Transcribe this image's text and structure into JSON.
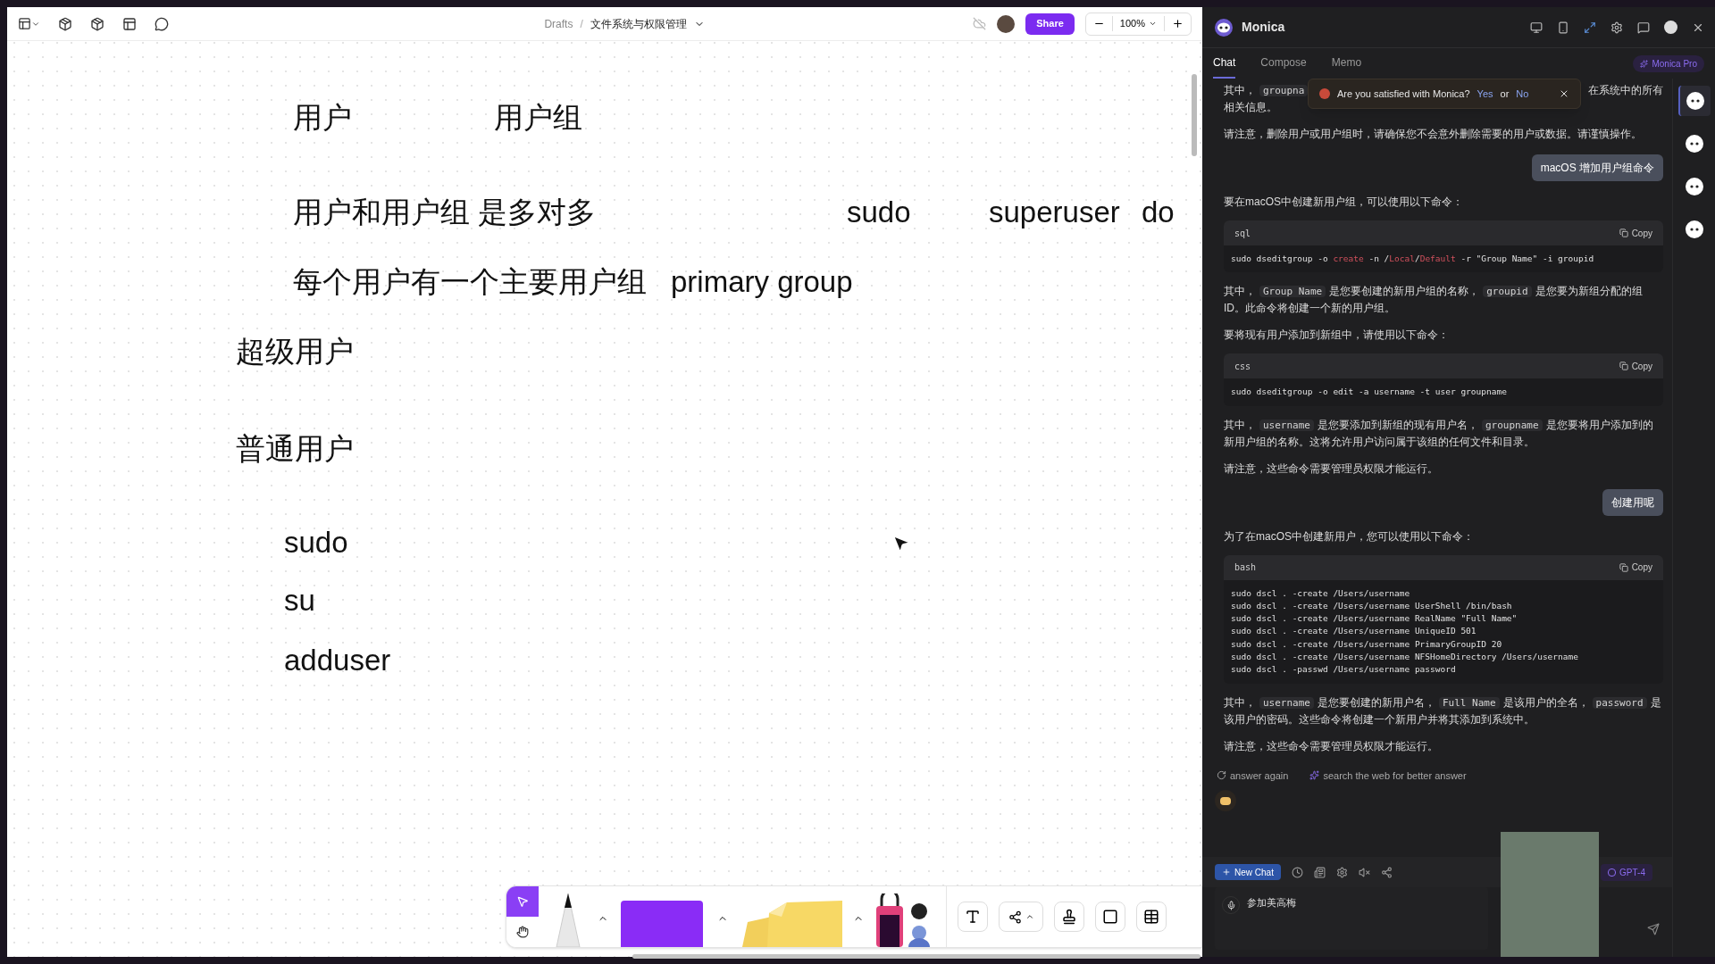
{
  "editor": {
    "breadcrumb": "Drafts",
    "separator": "/",
    "file_title": "文件系统与权限管理",
    "share_button": "Share",
    "zoom": "100%"
  },
  "canvas_texts": [
    {
      "text": "用户"
    },
    {
      "text": "用户组"
    },
    {
      "text": "用户和用户组 是多对多"
    },
    {
      "text": "sudo"
    },
    {
      "text": "superuser"
    },
    {
      "text": "do"
    },
    {
      "text": "每个用户有一个主要用户组"
    },
    {
      "text": "primary group"
    },
    {
      "text": "超级用户"
    },
    {
      "text": "普通用户"
    },
    {
      "text": "sudo"
    },
    {
      "text": "su"
    },
    {
      "text": "adduser"
    }
  ],
  "toolbar": {
    "tools": [
      {
        "kind": "select",
        "selected": true
      },
      {
        "kind": "hand",
        "selected": false
      }
    ]
  },
  "assistant": {
    "title": "Monica",
    "tabs": [
      {
        "label": "Chat",
        "selected": true
      },
      {
        "label": "Compose",
        "selected": false
      },
      {
        "label": "Memo",
        "selected": false
      }
    ],
    "pro_badge": "Monica Pro",
    "toast": {
      "question": "Are you satisfied with Monica?",
      "yes": "Yes",
      "or": "or",
      "no": "No"
    },
    "bots": [
      {
        "selected": true
      },
      {
        "selected": false
      },
      {
        "selected": false
      },
      {
        "selected": false
      }
    ],
    "messages": [
      {
        "kind": "assistant",
        "blocks": [
          {
            "kind": "obscured",
            "left": [
              {
                "text": "其中，"
              },
              {
                "text": "groupna",
                "code": true
              }
            ],
            "right": "在系统中的所有",
            "next_line": "相关信息。"
          },
          {
            "kind": "text",
            "segments": [
              {
                "text": "请注意，删除用户或用户组时，请确保您不会意外删除需要的用户或数据。请谨慎操作。"
              }
            ]
          }
        ]
      },
      {
        "kind": "user",
        "text": "macOS 增加用户组命令"
      },
      {
        "kind": "assistant",
        "blocks": [
          {
            "kind": "text",
            "segments": [
              {
                "text": "要在macOS中创建新用户组，可以使用以下命令："
              }
            ]
          },
          {
            "kind": "code",
            "language": "sql",
            "copy": "Copy",
            "lines": [
              [
                {
                  "text": "sudo dseditgroup -o "
                },
                {
                  "text": "create",
                  "keyword": true
                },
                {
                  "text": " -n /"
                },
                {
                  "text": "Local",
                  "keyword": true
                },
                {
                  "text": "/"
                },
                {
                  "text": "Default",
                  "keyword": true
                },
                {
                  "text": " -r \"Group Name\" -i groupid"
                }
              ]
            ]
          },
          {
            "kind": "text",
            "segments": [
              {
                "text": "其中，"
              },
              {
                "text": "Group Name",
                "code": true
              },
              {
                "text": "是您要创建的新用户组的名称，"
              },
              {
                "text": "groupid",
                "code": true
              },
              {
                "text": "是您要为新组分配的组ID。此命令将创建一个新的用户组。"
              }
            ]
          },
          {
            "kind": "text",
            "segments": [
              {
                "text": "要将现有用户添加到新组中，请使用以下命令："
              }
            ]
          },
          {
            "kind": "code",
            "language": "css",
            "copy": "Copy",
            "lines": [
              [
                {
                  "text": "sudo dseditgroup -o edit -a username -t user groupname"
                }
              ]
            ]
          },
          {
            "kind": "text",
            "segments": [
              {
                "text": "其中，"
              },
              {
                "text": "username",
                "code": true
              },
              {
                "text": "是您要添加到新组的现有用户名，"
              },
              {
                "text": "groupname",
                "code": true
              },
              {
                "text": "是您要将用户添加到的新用户组的名称。这将允许用户访问属于该组的任何文件和目录。"
              }
            ]
          },
          {
            "kind": "text",
            "segments": [
              {
                "text": "请注意，这些命令需要管理员权限才能运行。"
              }
            ]
          }
        ]
      },
      {
        "kind": "user",
        "text": "创建用呢"
      },
      {
        "kind": "assistant",
        "blocks": [
          {
            "kind": "text",
            "segments": [
              {
                "text": "为了在macOS中创建新用户，您可以使用以下命令："
              }
            ]
          },
          {
            "kind": "code",
            "language": "bash",
            "copy": "Copy",
            "lines": [
              [
                {
                  "text": "sudo dscl . -create /Users/username"
                }
              ],
              [
                {
                  "text": "sudo dscl . -create /Users/username UserShell /bin/bash"
                }
              ],
              [
                {
                  "text": "sudo dscl . -create /Users/username RealName \"Full Name\""
                }
              ],
              [
                {
                  "text": "sudo dscl . -create /Users/username UniqueID 501"
                }
              ],
              [
                {
                  "text": "sudo dscl . -create /Users/username PrimaryGroupID 20"
                }
              ],
              [
                {
                  "text": "sudo dscl . -create /Users/username NFSHomeDirectory /Users/username"
                }
              ],
              [
                {
                  "text": "sudo dscl . -passwd /Users/username password"
                }
              ]
            ]
          },
          {
            "kind": "text",
            "segments": [
              {
                "text": "其中，"
              },
              {
                "text": "username",
                "code": true
              },
              {
                "text": "是您要创建的新用户名，"
              },
              {
                "text": "Full Name",
                "code": true
              },
              {
                "text": "是该用户的全名，"
              },
              {
                "text": "password",
                "code": true
              },
              {
                "text": "是该用户的密码。这些命令将创建一个新用户并将其添加到系统中。"
              }
            ]
          },
          {
            "kind": "text",
            "segments": [
              {
                "text": "请注意，这些命令需要管理员权限才能运行。"
              }
            ]
          }
        ]
      }
    ],
    "actions": [
      {
        "kind": "retry",
        "label": "answer again"
      },
      {
        "kind": "web",
        "label": "search the web for better answer"
      }
    ],
    "new_chat": "New Chat",
    "model": "GPT-4",
    "input": {
      "value": "参加美高梅"
    }
  }
}
